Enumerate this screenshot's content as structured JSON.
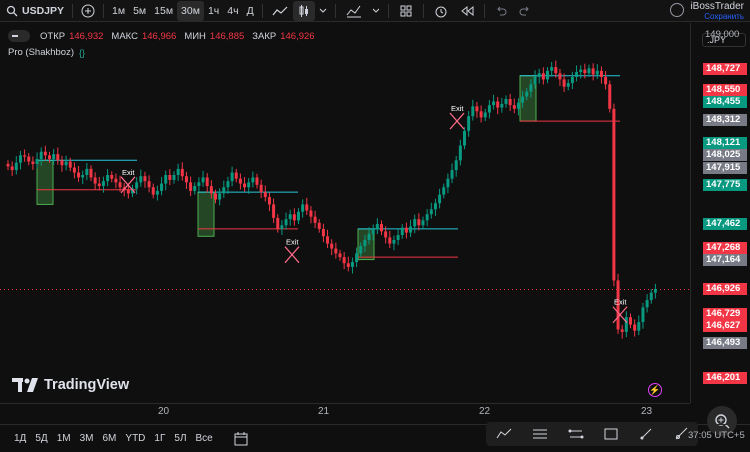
{
  "toolbar": {
    "symbol": "USDJPY",
    "intervals": [
      "1м",
      "5м",
      "15м",
      "30м",
      "1ч",
      "4ч",
      "Д"
    ],
    "active_interval": "30м"
  },
  "account": {
    "name": "iBossTrader",
    "save_label": "Сохранить"
  },
  "legend": {
    "open_label": "ОТКР",
    "open": "146,932",
    "high_label": "МАКС",
    "high": "146,966",
    "low_label": "МИН",
    "low": "146,885",
    "close_label": "ЗАКР",
    "close": "146,926"
  },
  "indicator": {
    "name": "Pro (Shakhboz)",
    "braces": "{}"
  },
  "currency_select": ".JPY",
  "scale": {
    "plain": [
      {
        "text": "149,000"
      }
    ],
    "labels": [
      {
        "text": "148,727",
        "color": "#f23645"
      },
      {
        "text": "148,550",
        "color": "#f23645"
      },
      {
        "text": "148,455",
        "color": "#089981"
      },
      {
        "text": "148,312",
        "color": "#787b86"
      },
      {
        "text": "148,121",
        "color": "#089981"
      },
      {
        "text": "148,025",
        "color": "#787b86"
      },
      {
        "text": "147,915",
        "color": "#787b86"
      },
      {
        "text": "147,775",
        "color": "#089981"
      },
      {
        "text": "147,462",
        "color": "#089981"
      },
      {
        "text": "147,268",
        "color": "#f23645"
      },
      {
        "text": "147,164",
        "color": "#787b86"
      },
      {
        "text": "146,926",
        "color": "#f23645"
      },
      {
        "text": "146,729",
        "color": "#f23645"
      },
      {
        "text": "146,627",
        "color": "#f23645"
      },
      {
        "text": "146,493",
        "color": "#787b86"
      },
      {
        "text": "146,201",
        "color": "#f23645"
      }
    ]
  },
  "time_axis": [
    "20",
    "21",
    "22",
    "23"
  ],
  "bottom": {
    "ranges": [
      "1Д",
      "5Д",
      "1М",
      "3М",
      "6М",
      "YTD",
      "1Г",
      "5Л",
      "Все"
    ],
    "clock": "37:05 UTC+5"
  },
  "logo_text": "TradingView",
  "exit_label": "Exit",
  "colors": {
    "up": "#089981",
    "down": "#f23645",
    "cyan": "#26c6da",
    "zone": "#4caf50"
  },
  "chart_data": {
    "type": "candlestick",
    "series": [
      {
        "name": "USDJPY",
        "close": [
          147.93,
          147.9,
          147.96,
          148.02,
          148.01,
          147.97,
          147.95,
          147.99,
          148.05,
          148.02,
          147.99,
          148.03,
          147.98,
          147.94,
          147.97,
          147.92,
          147.88,
          147.84,
          147.86,
          147.91,
          147.84,
          147.79,
          147.77,
          147.81,
          147.86,
          147.83,
          147.8,
          147.76,
          147.74,
          147.71,
          147.75,
          147.8,
          147.85,
          147.81,
          147.76,
          147.7,
          147.73,
          147.79,
          147.86,
          147.82,
          147.86,
          147.91,
          147.85,
          147.8,
          147.73,
          147.77,
          147.8,
          147.84,
          147.77,
          147.71,
          147.66,
          147.71,
          147.76,
          147.81,
          147.88,
          147.83,
          147.79,
          147.76,
          147.8,
          147.84,
          147.78,
          147.72,
          147.68,
          147.62,
          147.51,
          147.42,
          147.45,
          147.5,
          147.54,
          147.49,
          147.56,
          147.62,
          147.57,
          147.52,
          147.47,
          147.42,
          147.36,
          147.3,
          147.26,
          147.22,
          147.19,
          147.14,
          147.11,
          147.15,
          147.22,
          147.28,
          147.33,
          147.38,
          147.42,
          147.46,
          147.4,
          147.35,
          147.3,
          147.33,
          147.37,
          147.43,
          147.39,
          147.44,
          147.5,
          147.45,
          147.49,
          147.54,
          147.58,
          147.63,
          147.7,
          147.76,
          147.83,
          147.9,
          147.98,
          148.1,
          148.22,
          148.34,
          148.42,
          148.38,
          148.33,
          148.37,
          148.43,
          148.46,
          148.41,
          148.44,
          148.48,
          148.43,
          148.4,
          148.45,
          148.5,
          148.54,
          148.6,
          148.66,
          148.69,
          148.64,
          148.71,
          148.74,
          148.69,
          148.64,
          148.58,
          148.61,
          148.66,
          148.7,
          148.72,
          148.69,
          148.73,
          148.68,
          148.71,
          148.66,
          148.6,
          148.4,
          147.0,
          146.6,
          146.58,
          146.7,
          146.64,
          146.59,
          146.66,
          146.78,
          146.84,
          146.9,
          146.93
        ]
      }
    ],
    "x_ticks": [
      "20",
      "21",
      "22",
      "23"
    ]
  }
}
